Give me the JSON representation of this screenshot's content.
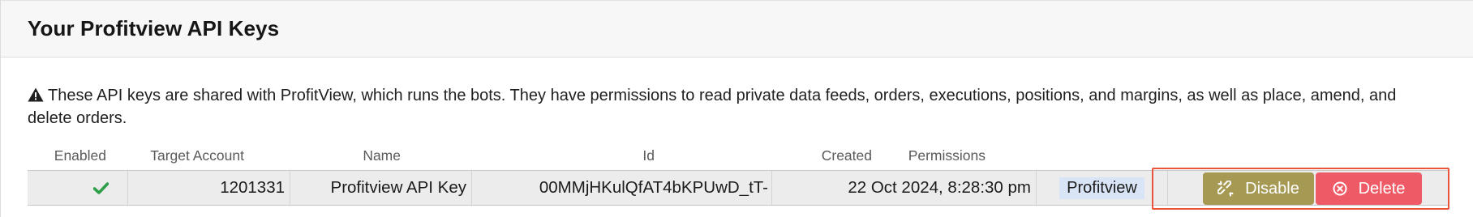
{
  "panel": {
    "title": "Your Profitview API Keys",
    "notice": "These API keys are shared with ProfitView, which runs the bots. They have permissions to read private data feeds, orders, executions, positions, and margins, as well as place, amend, and delete orders."
  },
  "table": {
    "headers": {
      "enabled": "Enabled",
      "target_account": "Target Account",
      "name": "Name",
      "id": "Id",
      "created": "Created",
      "permissions": "Permissions"
    },
    "rows": [
      {
        "enabled": true,
        "target_account": "1201331",
        "name": "Profitview API Key",
        "id": "00MMjHKulQfAT4bKPUwD_tT-",
        "created": "22 Oct 2024, 8:28:30 pm",
        "permissions": "Profitview"
      }
    ],
    "actions": {
      "disable_label": "Disable",
      "delete_label": "Delete"
    }
  },
  "colors": {
    "disable_button": "#a59954",
    "delete_button": "#ee5b66",
    "highlight_border": "#e8553b",
    "enabled_check": "#2e9e4a",
    "permission_badge": "#d9e4f6"
  },
  "icons": {
    "notice": "warning-triangle-icon",
    "enabled": "checkmark-icon",
    "disable": "broken-link-icon",
    "delete": "circle-x-icon"
  }
}
